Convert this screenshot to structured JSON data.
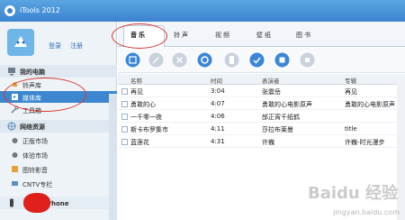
{
  "window": {
    "title": "iTools 2012"
  },
  "sidebar": {
    "login_label": "登录",
    "register_label": "注册",
    "sections": [
      {
        "label": "我的电脑",
        "items": [
          "铃声库",
          "媒体库",
          "工具箱"
        ]
      },
      {
        "label": "网络资源",
        "items": [
          "正版市场",
          "体验市场",
          "图铃影音",
          "CNTV专栏"
        ]
      }
    ],
    "device_label": "的 iPhone"
  },
  "tabs": [
    "音乐",
    "铃声",
    "视频",
    "壁纸",
    "图书"
  ],
  "table": {
    "columns": [
      "名称",
      "时间",
      "表演者",
      "专辑"
    ],
    "rows": [
      [
        "再见",
        "3:04",
        "张震岳",
        "再见"
      ],
      [
        "勇敢的心",
        "4:07",
        "勇敢的心电影原声",
        "勇敢的心电影原声"
      ],
      [
        "一千零一夜",
        "4:06",
        "邰正宵千纸鹤",
        ""
      ],
      [
        "斯卡布罗集市",
        "4:11",
        "莎拉布莱曼",
        "title"
      ],
      [
        "蓝莲花",
        "4:31",
        "许巍",
        "许巍-时光漫步"
      ]
    ]
  },
  "watermark": {
    "brand": "Baidu 经验",
    "url": "jingyan.baidu.com"
  },
  "colors": {
    "titlebar": "#3b83cf",
    "selected": "#3d87d0",
    "annotation": "#d9352a"
  }
}
